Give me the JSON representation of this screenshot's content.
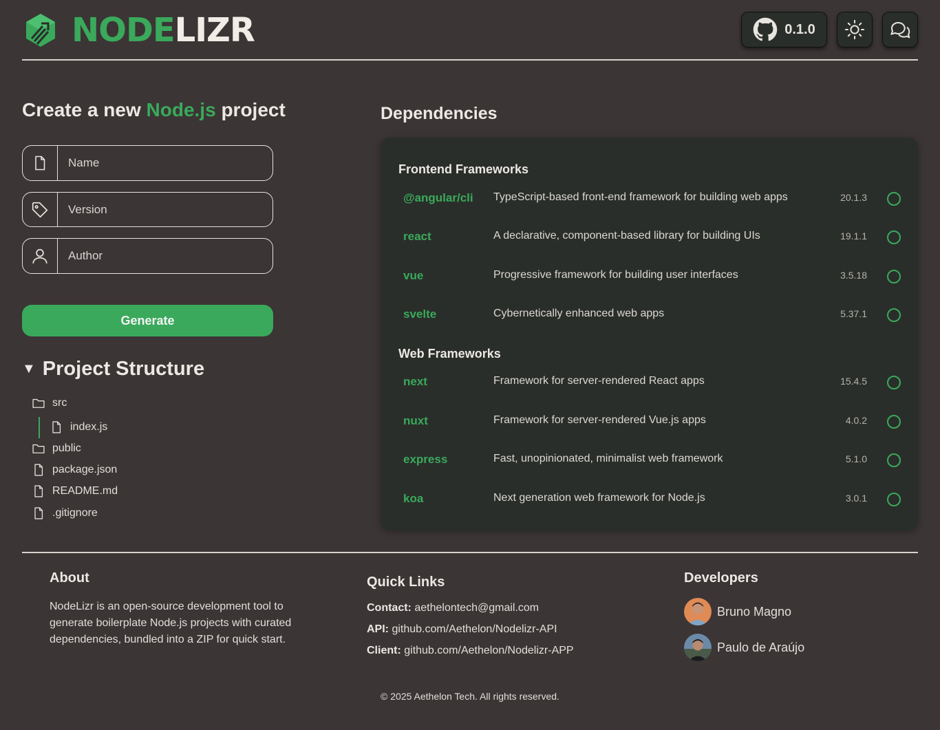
{
  "header": {
    "logo_part1": "NODE",
    "logo_part2": "LIZR",
    "version": "0.1.0",
    "github_icon": "github-icon",
    "theme_icon": "sun-icon",
    "chat_icon": "chat-bubbles-icon"
  },
  "create": {
    "title_pre": "Create a new ",
    "title_accent": "Node.js",
    "title_post": " project",
    "fields": {
      "name": {
        "placeholder": "Name",
        "value": "",
        "icon": "file-icon"
      },
      "version": {
        "placeholder": "Version",
        "value": "",
        "icon": "tag-icon"
      },
      "author": {
        "placeholder": "Author",
        "value": "",
        "icon": "user-icon"
      }
    },
    "generate_label": "Generate"
  },
  "structure": {
    "toggle": "▼",
    "title": "Project Structure",
    "items": [
      {
        "name": "src",
        "type": "folder"
      },
      {
        "name": "index.js",
        "type": "file"
      },
      {
        "name": "public",
        "type": "folder"
      },
      {
        "name": "package.json",
        "type": "file"
      },
      {
        "name": "README.md",
        "type": "file"
      },
      {
        "name": ".gitignore",
        "type": "file"
      }
    ]
  },
  "dependencies": {
    "title": "Dependencies",
    "categories": [
      {
        "title": "Frontend Frameworks",
        "items": [
          {
            "name": "@angular/cli",
            "desc": "TypeScript-based front-end framework for building web apps",
            "version": "20.1.3"
          },
          {
            "name": "react",
            "desc": "A declarative, component-based library for building UIs",
            "version": "19.1.1"
          },
          {
            "name": "vue",
            "desc": "Progressive framework for building user interfaces",
            "version": "3.5.18"
          },
          {
            "name": "svelte",
            "desc": "Cybernetically enhanced web apps",
            "version": "5.37.1"
          }
        ]
      },
      {
        "title": "Web Frameworks",
        "items": [
          {
            "name": "next",
            "desc": "Framework for server-rendered React apps",
            "version": "15.4.5"
          },
          {
            "name": "nuxt",
            "desc": "Framework for server-rendered Vue.js apps",
            "version": "4.0.2"
          },
          {
            "name": "express",
            "desc": "Fast, unopinionated, minimalist web framework",
            "version": "5.1.0"
          },
          {
            "name": "koa",
            "desc": "Next generation web framework for Node.js",
            "version": "3.0.1"
          }
        ]
      }
    ]
  },
  "footer": {
    "about_title": "About",
    "about_text": "NodeLizr is an open-source development tool to generate boilerplate Node.js projects with curated dependencies, bundled into a ZIP for quick start.",
    "links_title": "Quick Links",
    "links": [
      {
        "label": "Contact:",
        "value": "aethelontech@gmail.com"
      },
      {
        "label": "API:",
        "value": "github.com/Aethelon/Nodelizr-API"
      },
      {
        "label": "Client:",
        "value": "github.com/Aethelon/Nodelizr-APP"
      }
    ],
    "devs_title": "Developers",
    "devs": [
      {
        "name": "Bruno Magno"
      },
      {
        "name": "Paulo de Araújo"
      }
    ],
    "copyright": "© 2025 Aethelon Tech. All rights reserved."
  },
  "colors": {
    "accent": "#3aa95b",
    "background": "#3b3535",
    "panel": "#2a2e2a"
  }
}
